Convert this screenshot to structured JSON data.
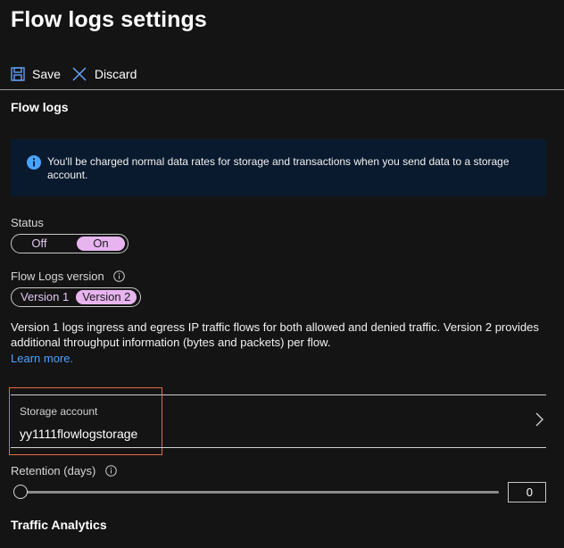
{
  "page": {
    "title": "Flow logs settings"
  },
  "toolbar": {
    "save_label": "Save",
    "discard_label": "Discard"
  },
  "sections": {
    "flow_logs": "Flow logs",
    "traffic_analytics": "Traffic Analytics"
  },
  "info_banner": {
    "text": "You'll be charged normal data rates for storage and transactions when you send data to a storage account."
  },
  "status": {
    "label": "Status",
    "options": [
      "Off",
      "On"
    ],
    "selected": "On"
  },
  "flow_logs_version": {
    "label": "Flow Logs version",
    "options": [
      "Version 1",
      "Version 2"
    ],
    "selected": "Version 2"
  },
  "version_description": "Version 1 logs ingress and egress IP traffic flows for both allowed and denied traffic. Version 2 provides additional throughput information (bytes and packets) per flow.",
  "learn_more": "Learn more.",
  "storage": {
    "label": "Storage account",
    "value": "yy1111flowlogstorage"
  },
  "retention": {
    "label": "Retention (days)",
    "value": "0",
    "slider_fraction": 0
  },
  "colors": {
    "accent_toggle": "#e8b4f0",
    "link": "#4aa3ff",
    "highlight_box": "#e86a4a",
    "info_bg": "#0a1a2e"
  }
}
